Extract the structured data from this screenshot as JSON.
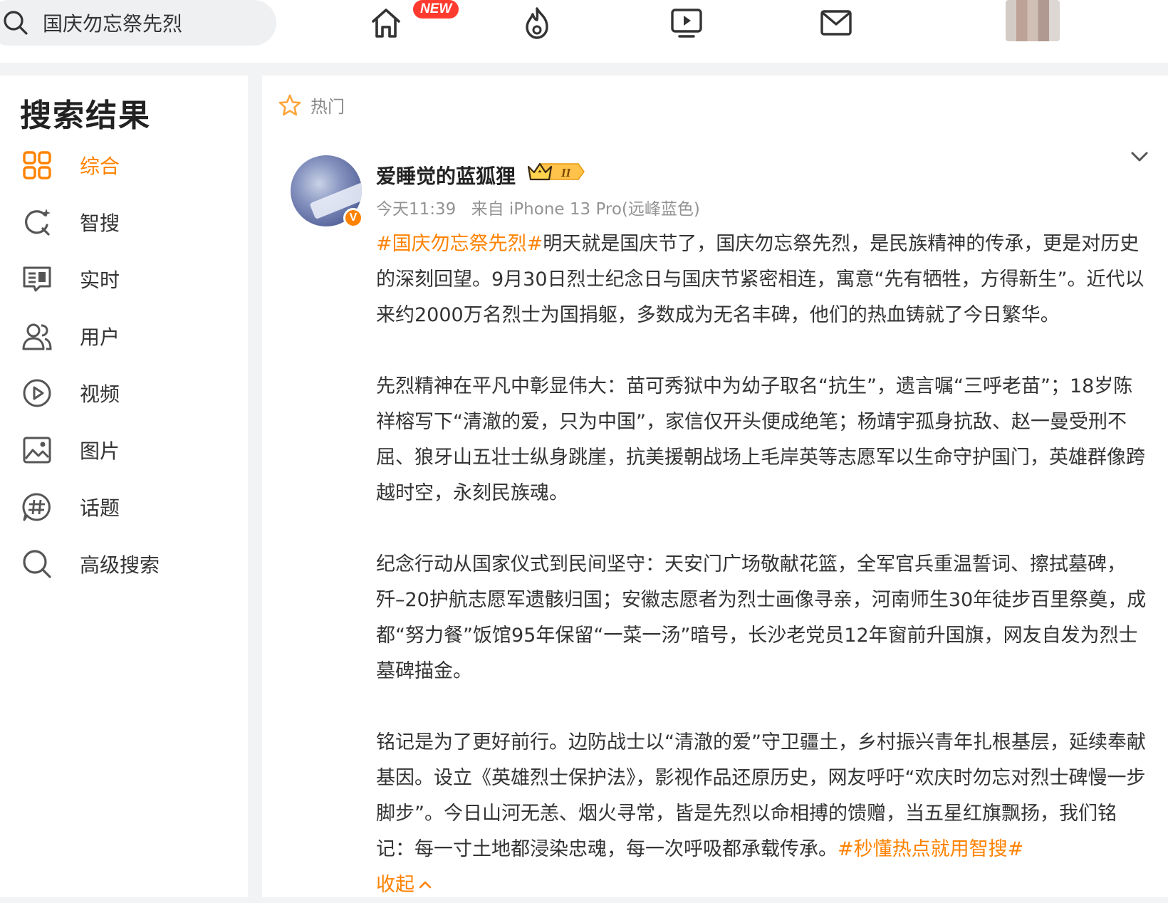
{
  "search": {
    "query": "国庆勿忘祭先烈"
  },
  "nav": {
    "new_badge": "NEW",
    "icons": [
      "home-icon",
      "hot-icon",
      "video-icon",
      "mail-icon"
    ]
  },
  "sidebar": {
    "title": "搜索结果",
    "items": [
      {
        "label": "综合",
        "icon": "grid-icon",
        "active": true
      },
      {
        "label": "智搜",
        "icon": "smart-search-icon"
      },
      {
        "label": "实时",
        "icon": "realtime-icon"
      },
      {
        "label": "用户",
        "icon": "users-icon"
      },
      {
        "label": "视频",
        "icon": "play-icon"
      },
      {
        "label": "图片",
        "icon": "image-icon"
      },
      {
        "label": "话题",
        "icon": "topic-icon"
      },
      {
        "label": "高级搜索",
        "icon": "search-icon"
      }
    ]
  },
  "post": {
    "section_label": "热门",
    "username": "爱睡觉的蓝狐狸",
    "verified_mark": "V",
    "badge_numeral": "II",
    "time": "今天11:39",
    "source": "来自 iPhone 13 Pro(远峰蓝色)",
    "hashtag_start": "#国庆勿忘祭先烈#",
    "para1": "明天就是国庆节了，国庆勿忘祭先烈，是民族精神的传承，更是对历史的深刻回望。9月30日烈士纪念日与国庆节紧密相连，寓意“先有牺牲，方得新生”。近代以来约2000万名烈士为国捐躯，多数成为无名丰碑，他们的热血铸就了今日繁华。",
    "para2": "先烈精神在平凡中彰显伟大：苗可秀狱中为幼子取名“抗生”，遗言嘱“三呼老苗”；18岁陈祥榕写下“清澈的爱，只为中国”，家信仅开头便成绝笔；杨靖宇孤身抗敌、赵一曼受刑不屈、狼牙山五壮士纵身跳崖，抗美援朝战场上毛岸英等志愿军以生命守护国门，英雄群像跨越时空，永刻民族魂。",
    "para3": "纪念行动从国家仪式到民间坚守：天安门广场敬献花篮，全军官兵重温誓词、擦拭墓碑，歼–20护航志愿军遗骸归国；安徽志愿者为烈士画像寻亲，河南师生30年徒步百里祭奠，成都“努力餐”饭馆95年保留“一菜一汤”暗号，长沙老党员12年窗前升国旗，网友自发为烈士墓碑描金。",
    "para4": "铭记是为了更好前行。边防战士以“清澈的爱”守卫疆土，乡村振兴青年扎根基层，延续奉献基因。设立《英雄烈士保护法》，影视作品还原历史，网友呼吁“欢庆时勿忘对烈士碑慢一步脚步”。今日山河无恙、烟火寻常，皆是先烈以命相搏的馈赠，当五星红旗飘扬，我们铭记：每一寸土地都浸染忠魂，每一次呼吸都承载传承。",
    "hashtag_end": "#秒懂热点就用智搜#",
    "collapse_label": "收起"
  },
  "colors": {
    "accent": "#ff8200",
    "badge_red": "#ff3b30"
  }
}
